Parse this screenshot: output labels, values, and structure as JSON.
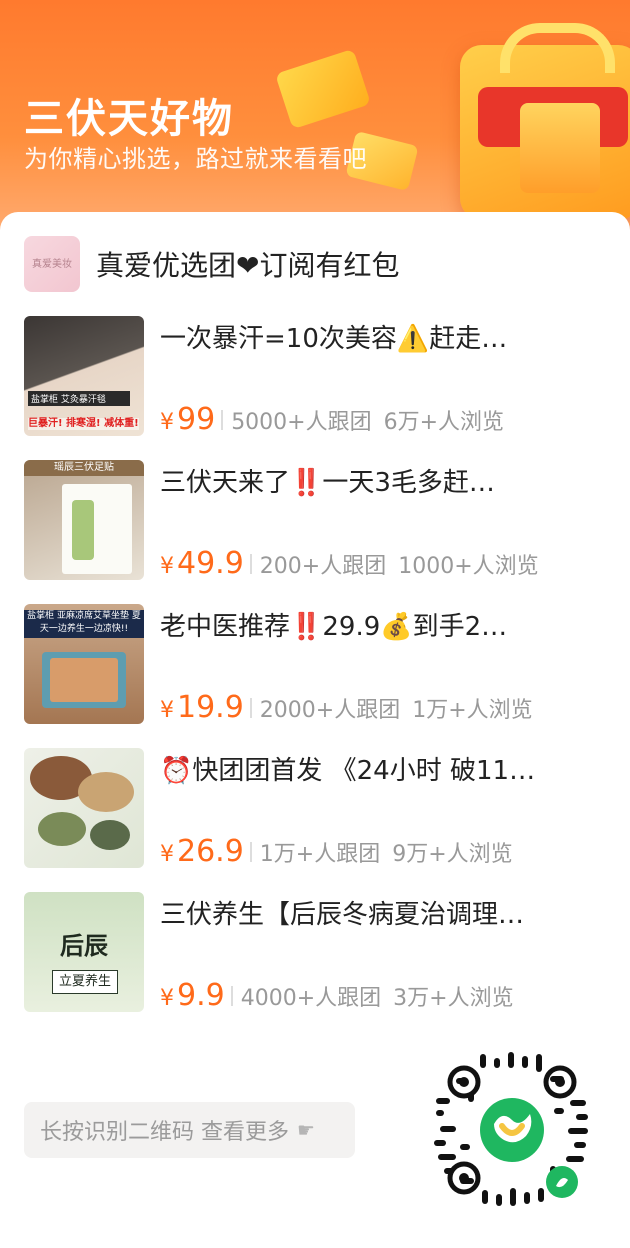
{
  "header": {
    "title": "三伏天好物",
    "subtitle": "为你精心挑选，路过就来看看吧"
  },
  "shop": {
    "logo_text": "真爱美妆",
    "name": "真爱优选团❤订阅有红包"
  },
  "currency": "¥",
  "items": [
    {
      "title": "一次暴汗=10次美容⚠️赶走…",
      "price": "99",
      "joined": "5000+人跟团",
      "views": "6万+人浏览",
      "thumb_tag": "盐掌柜 艾灸暴汗毯",
      "thumb_red": "巨暴汗! 排寒湿! 减体重!"
    },
    {
      "title": "三伏天来了‼️一天3毛多赶…",
      "price": "49.9",
      "joined": "200+人跟团",
      "views": "1000+人浏览",
      "thumb_tag": "瑶辰三伏足贴"
    },
    {
      "title": "老中医推荐‼️29.9💰到手2…",
      "price": "19.9",
      "joined": "2000+人跟团",
      "views": "1万+人浏览",
      "thumb_tag": "盐掌柜 亚麻凉席艾草坐垫 夏天一边养生一边凉快!!"
    },
    {
      "title": "⏰快团团首发 《24小时 破11…",
      "price": "26.9",
      "joined": "1万+人跟团",
      "views": "9万+人浏览"
    },
    {
      "title": "三伏养生【后辰冬病夏治调理…",
      "price": "9.9",
      "joined": "4000+人跟团",
      "views": "3万+人浏览",
      "thumb_big": "后辰",
      "thumb_small": "立夏养生"
    }
  ],
  "footer": {
    "more_label": "长按识别二维码 查看更多",
    "more_icon": "hand-point-right-icon"
  },
  "colors": {
    "accent": "#ff6a1a",
    "header_bg": "#ff7a2e",
    "muted": "#999999"
  }
}
